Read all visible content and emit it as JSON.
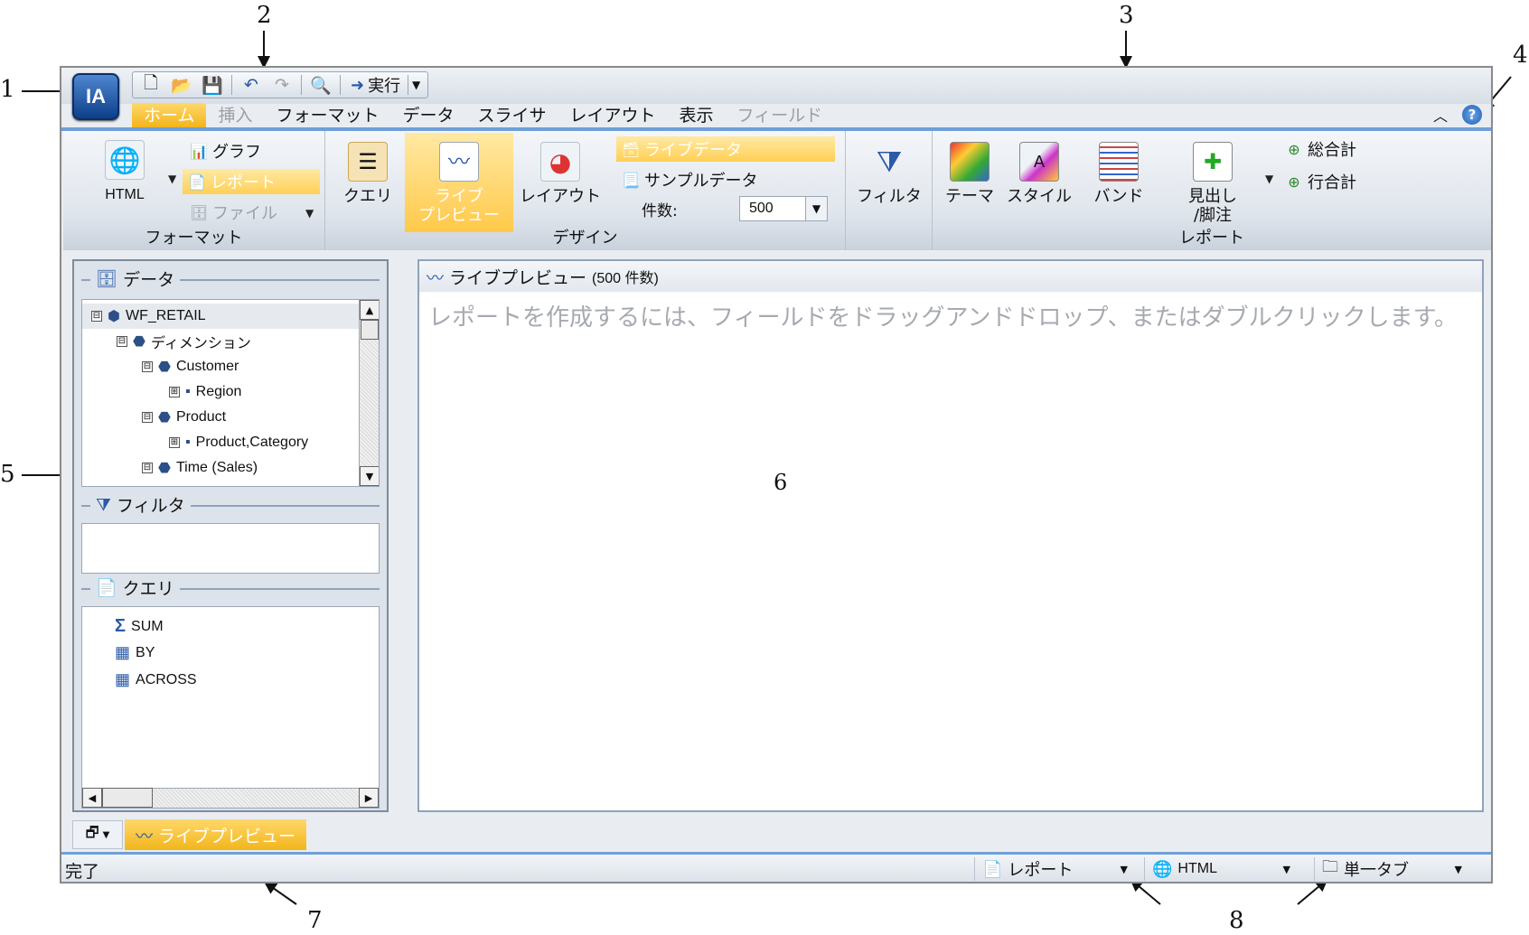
{
  "callouts": [
    "1",
    "2",
    "3",
    "4",
    "5",
    "6",
    "7",
    "8"
  ],
  "app": {
    "logo_text": "IA",
    "quick_access": {
      "run_label": "実行"
    },
    "tabs": [
      {
        "label": "ホーム",
        "state": "active"
      },
      {
        "label": "挿入",
        "state": "disabled"
      },
      {
        "label": "フォーマット",
        "state": "normal"
      },
      {
        "label": "データ",
        "state": "normal"
      },
      {
        "label": "スライサ",
        "state": "normal"
      },
      {
        "label": "レイアウト",
        "state": "normal"
      },
      {
        "label": "表示",
        "state": "normal"
      },
      {
        "label": "フィールド",
        "state": "disabled"
      }
    ],
    "help_label": "?"
  },
  "ribbon": {
    "format_group": {
      "label": "フォーマット",
      "html_label": "HTML",
      "graph_label": "グラフ",
      "report_label": "レポート",
      "file_label": "ファイル"
    },
    "design_group": {
      "label": "デザイン",
      "query_label": "クエリ",
      "live_preview_line1": "ライブ",
      "live_preview_line2": "プレビュー",
      "layout_label": "レイアウト",
      "live_data_label": "ライブデータ",
      "sample_data_label": "サンプルデータ",
      "count_label": "件数:",
      "count_value": "500"
    },
    "filter_label": "フィルタ",
    "report_group": {
      "label": "レポート",
      "theme_label": "テーマ",
      "style_label": "スタイル",
      "band_label": "バンド",
      "header_footer_line1": "見出し",
      "header_footer_line2": "/脚注",
      "grand_total_label": "総合計",
      "row_total_label": "行合計"
    }
  },
  "left_panel": {
    "data_title": "データ",
    "tree": [
      {
        "label": "WF_RETAIL",
        "toggle": "⊟",
        "level": 0
      },
      {
        "label": "ディメンション",
        "toggle": "⊟",
        "level": 1
      },
      {
        "label": "Customer",
        "toggle": "⊟",
        "level": 2
      },
      {
        "label": "Region",
        "toggle": "⊞",
        "level": 3
      },
      {
        "label": "Product",
        "toggle": "⊟",
        "level": 2
      },
      {
        "label": "Product,Category",
        "toggle": "⊞",
        "level": 3
      },
      {
        "label": "Time (Sales)",
        "toggle": "⊟",
        "level": 2
      }
    ],
    "filter_title": "フィルタ",
    "query_title": "クエリ",
    "query_items": [
      "SUM",
      "BY",
      "ACROSS"
    ]
  },
  "main": {
    "title": "ライブプレビュー",
    "count_text": "(500 件数)",
    "hint": "レポートを作成するには、フィールドをドラッグアンドドロップ、またはダブルクリックします。"
  },
  "bottom_tab": {
    "label": "ライブプレビュー"
  },
  "status": {
    "text": "完了",
    "output_type": "レポート",
    "format": "HTML",
    "tab_mode": "単一タブ"
  }
}
